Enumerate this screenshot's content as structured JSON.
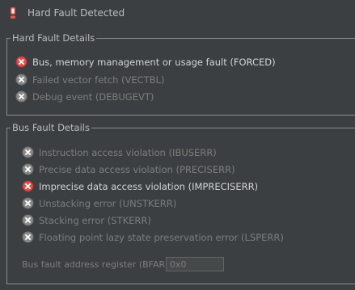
{
  "header": {
    "icon": "error-icon",
    "title": "Hard Fault Detected"
  },
  "hard_fault": {
    "legend": "Hard Fault Details",
    "items": [
      {
        "label": "Bus, memory management or usage fault (FORCED)",
        "active": true
      },
      {
        "label": "Failed vector fetch (VECTBL)",
        "active": false
      },
      {
        "label": "Debug event (DEBUGEVT)",
        "active": false
      }
    ]
  },
  "bus_fault": {
    "legend": "Bus Fault Details",
    "items": [
      {
        "label": "Instruction access violation (IBUSERR)",
        "active": false
      },
      {
        "label": "Precise data access violation (PRECISERR)",
        "active": false
      },
      {
        "label": "Imprecise data access violation (IMPRECISERR)",
        "active": true
      },
      {
        "label": "Unstacking error (UNSTKERR)",
        "active": false
      },
      {
        "label": "Stacking error (STKERR)",
        "active": false
      },
      {
        "label": "Floating point lazy state preservation error (LSPERR)",
        "active": false
      }
    ],
    "bfar_label": "Bus fault address register (BFAR):",
    "bfar_value": "0x0"
  },
  "colors": {
    "background": "#3c3f41",
    "active_icon": "#d9534f",
    "inactive_icon": "#8a8a8a"
  }
}
